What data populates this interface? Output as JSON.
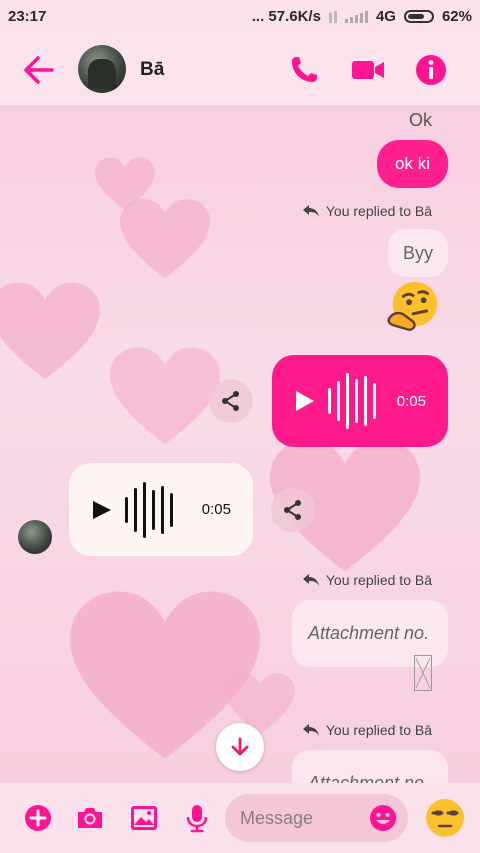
{
  "status_bar": {
    "time": "23:17",
    "network_speed": "... 57.6K/s",
    "network_type": "4G",
    "battery": "62%"
  },
  "header": {
    "back_icon": "arrow-left-icon",
    "contact_name": "Bā",
    "call_icon": "phone-icon",
    "video_icon": "video-camera-icon",
    "info_icon": "info-icon",
    "accent_color": "#ff1493"
  },
  "messages": {
    "incoming_text_top": "Ok",
    "outgoing_text_1": "ok ki",
    "reply_note_1": "You replied to Bā",
    "quoted_1": "Byy",
    "reaction_emoji": "thinking-face",
    "outgoing_voice_duration": "0:05",
    "incoming_voice_duration": "0:05",
    "reply_note_2": "You replied to Bā",
    "quoted_2": "Attachment no.",
    "reply_note_3": "You replied to Bā",
    "quoted_3": "Attachment no."
  },
  "composer": {
    "add_icon": "plus-circle-icon",
    "camera_icon": "camera-icon",
    "gallery_icon": "image-icon",
    "mic_icon": "microphone-icon",
    "placeholder": "Message",
    "emoji_icon": "smiley-icon",
    "quick_reaction": "unamused-face"
  }
}
